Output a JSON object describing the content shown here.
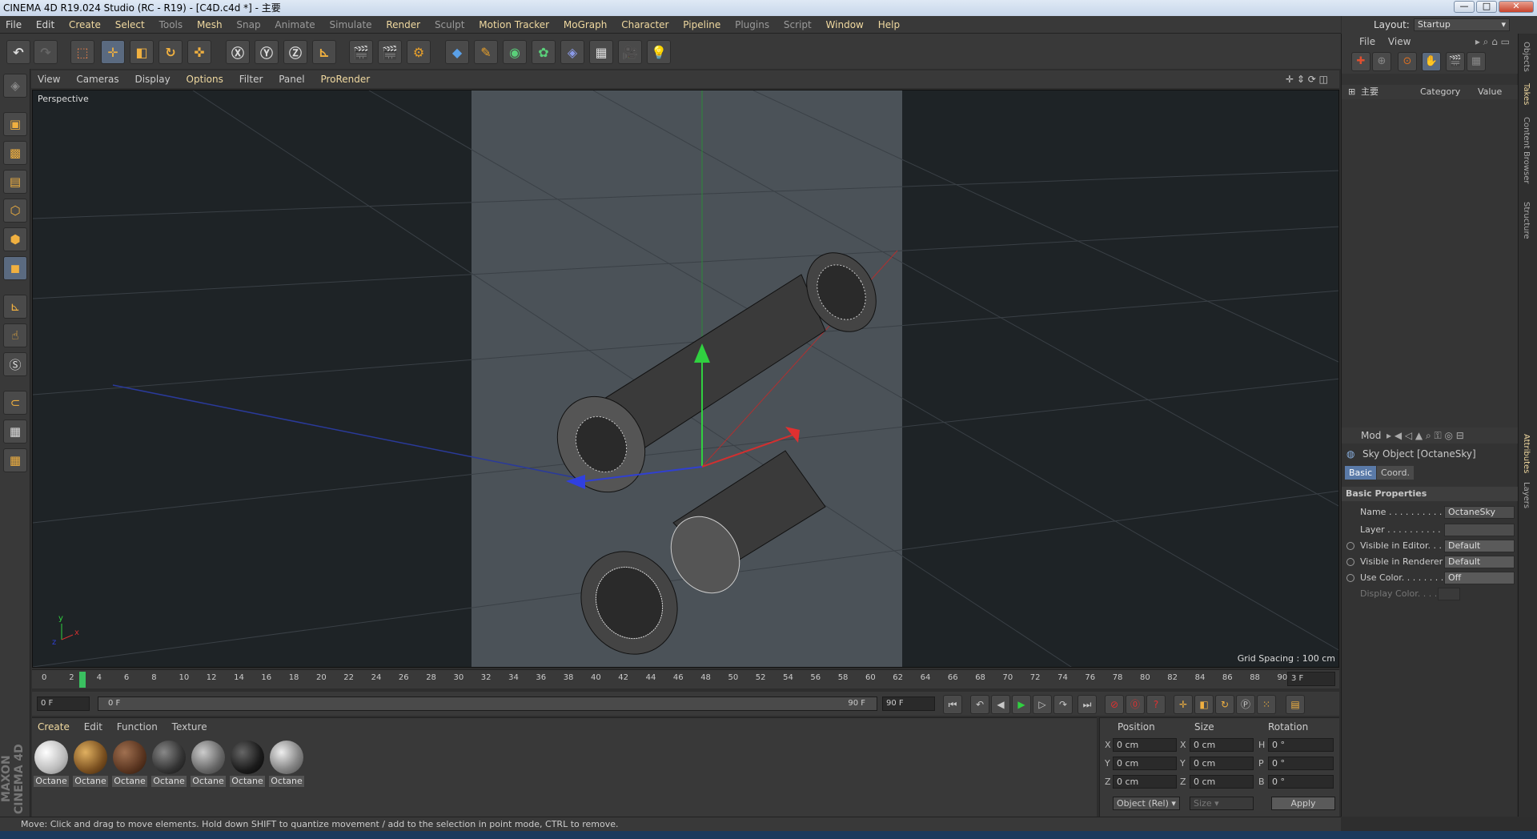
{
  "window": {
    "title": "CINEMA 4D R19.024 Studio (RC - R19) - [C4D.c4d *] - 主要"
  },
  "menu": [
    "File",
    "Edit",
    "Create",
    "Select",
    "Tools",
    "Mesh",
    "Snap",
    "Animate",
    "Simulate",
    "Render",
    "Sculpt",
    "Motion Tracker",
    "MoGraph",
    "Character",
    "Pipeline",
    "Plugins",
    "Script",
    "Window",
    "Help"
  ],
  "layout": {
    "label": "Layout:",
    "value": "Startup"
  },
  "viewport": {
    "menu": [
      "View",
      "Cameras",
      "Display",
      "Options",
      "Filter",
      "Panel",
      "ProRender"
    ],
    "camera_label": "Perspective",
    "grid_spacing": "Grid Spacing : 100 cm"
  },
  "timeline": {
    "ticks": [
      "0",
      "2",
      "4",
      "6",
      "8",
      "10",
      "12",
      "14",
      "16",
      "18",
      "20",
      "22",
      "24",
      "26",
      "28",
      "30",
      "32",
      "34",
      "36",
      "38",
      "40",
      "42",
      "44",
      "46",
      "48",
      "50",
      "52",
      "54",
      "56",
      "58",
      "60",
      "62",
      "64",
      "66",
      "68",
      "70",
      "72",
      "74",
      "76",
      "78",
      "80",
      "82",
      "84",
      "86",
      "88",
      "90"
    ],
    "current_frame": "3 F",
    "playhead_marker": "3"
  },
  "timebar": {
    "start": "0 F",
    "range_start": "0 F",
    "range_end": "90 F",
    "end": "90 F"
  },
  "material_panel": {
    "menu": [
      "Create",
      "Edit",
      "Function",
      "Texture"
    ],
    "materials": [
      "Octane",
      "Octane",
      "Octane",
      "Octane",
      "Octane",
      "Octane",
      "Octane"
    ]
  },
  "coords": {
    "headers": {
      "position": "Position",
      "size": "Size",
      "rotation": "Rotation"
    },
    "rows": [
      {
        "axis": "X",
        "pos": "0 cm",
        "size_axis": "X",
        "size": "0 cm",
        "rot_axis": "H",
        "rot": "0 °"
      },
      {
        "axis": "Y",
        "pos": "0 cm",
        "size_axis": "Y",
        "size": "0 cm",
        "rot_axis": "P",
        "rot": "0 °"
      },
      {
        "axis": "Z",
        "pos": "0 cm",
        "size_axis": "Z",
        "size": "0 cm",
        "rot_axis": "B",
        "rot": "0 °"
      }
    ],
    "mode": "Object (Rel)",
    "size_mode": "Size",
    "apply": "Apply"
  },
  "status": "Move: Click and drag to move elements. Hold down SHIFT to quantize movement / add to the selection in point mode, CTRL to remove.",
  "objects": {
    "menu": [
      "File",
      "View"
    ],
    "col_name": "主要",
    "col_category": "Category",
    "col_value": "Value"
  },
  "attributes": {
    "menu": "Mod",
    "title": "Sky Object [OctaneSky]",
    "tabs": [
      "Basic",
      "Coord."
    ],
    "section": "Basic Properties",
    "props": [
      {
        "name": "Name . . . . . . . . . . . .",
        "value": "OctaneSky"
      },
      {
        "name": "Layer . . . . . . . . . . . .",
        "value": ""
      },
      {
        "name": "Visible in Editor. . .",
        "value": "Default"
      },
      {
        "name": "Visible in Renderer",
        "value": "Default"
      },
      {
        "name": "Use Color. . . . . . . .",
        "value": "Off"
      },
      {
        "name": "Display Color. . . .",
        "value": ""
      }
    ]
  },
  "side_tabs": [
    "Objects",
    "Takes",
    "Content Browser",
    "Structure",
    "Attributes",
    "Layers"
  ],
  "logo": "MAXON CINEMA 4D"
}
